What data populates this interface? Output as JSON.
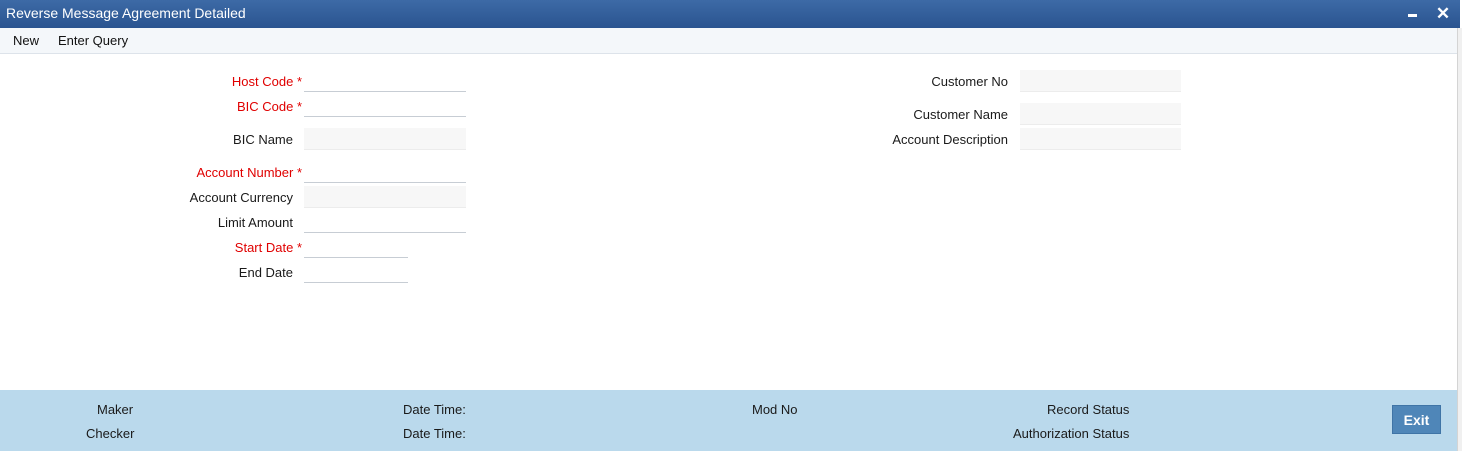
{
  "window": {
    "title": "Reverse Message Agreement Detailed",
    "minimize_icon": "minimize-icon",
    "close_icon": "close-icon",
    "close_glyph": "✕"
  },
  "menu": {
    "new_label": "New",
    "enter_query_label": "Enter Query"
  },
  "form": {
    "host_code": {
      "label": "Host Code",
      "value": ""
    },
    "bic_code": {
      "label": "BIC Code",
      "value": ""
    },
    "bic_name": {
      "label": "BIC Name",
      "value": ""
    },
    "account_number": {
      "label": "Account Number",
      "value": ""
    },
    "account_currency": {
      "label": "Account Currency",
      "value": ""
    },
    "limit_amount": {
      "label": "Limit Amount",
      "value": ""
    },
    "start_date": {
      "label": "Start Date",
      "value": ""
    },
    "end_date": {
      "label": "End Date",
      "value": ""
    },
    "customer_no": {
      "label": "Customer No",
      "value": ""
    },
    "customer_name": {
      "label": "Customer Name",
      "value": ""
    },
    "account_description": {
      "label": "Account Description",
      "value": ""
    }
  },
  "footer": {
    "maker_label": "Maker",
    "checker_label": "Checker",
    "date_time_label_1": "Date Time:",
    "date_time_label_2": "Date Time:",
    "mod_no_label": "Mod No",
    "record_status_label": "Record Status",
    "authorization_status_label": "Authorization Status",
    "exit_label": "Exit"
  },
  "colors": {
    "title_bar": "#2f5c99",
    "required_label": "#e00000",
    "footer_bg": "#bad9ec",
    "exit_button": "#4f86b8"
  }
}
